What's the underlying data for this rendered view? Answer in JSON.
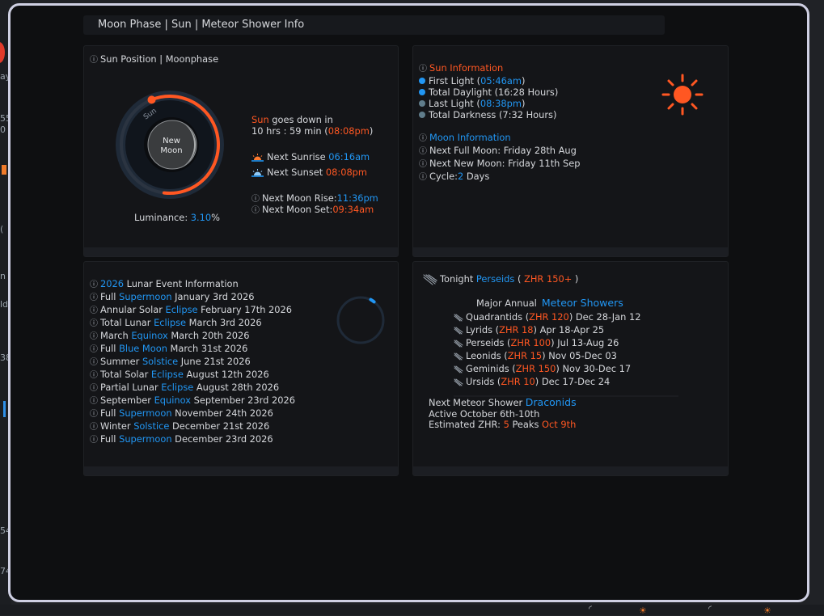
{
  "background": {
    "left_fragments": [
      "ay",
      "55",
      "0",
      "(",
      "n",
      "ld",
      "38",
      "54",
      "74"
    ]
  },
  "modal": {
    "title": "Moon Phase | Sun | Meteor Shower Info"
  },
  "sun_moon_panel": {
    "header": "Sun Position | Moonphase",
    "dial": {
      "sun_label": "Sun",
      "moon_phase_line1": "New",
      "moon_phase_line2": "Moon",
      "sun_progress_fraction": 0.58
    },
    "luminance_label": "Luminance:",
    "luminance_value": "3.10",
    "luminance_unit": "%",
    "sun_word": "Sun",
    "goes_down_text": "goes down in",
    "countdown": "10 hrs : 59 min",
    "countdown_paren_open": "(",
    "countdown_time": "08:08pm",
    "countdown_paren_close": ")",
    "next_sunrise_label": "Next Sunrise",
    "next_sunrise_time": "06:16am",
    "next_sunset_label": "Next Sunset",
    "next_sunset_time": "08:08pm",
    "moon_rise_label": "Next Moon Rise:",
    "moon_rise_time": "11:36pm",
    "moon_set_label": "Next Moon Set:",
    "moon_set_time": "09:34am"
  },
  "sun_info_panel": {
    "sun_header": "Sun Information",
    "first_light_label": "First Light (",
    "first_light_time": "05:46am",
    "first_light_close": ")",
    "total_daylight": "Total Daylight (16:28 Hours)",
    "last_light_label": "Last Light (",
    "last_light_time": "08:38pm",
    "last_light_close": ")",
    "total_darkness": "Total Darkness (7:32 Hours)",
    "moon_header": "Moon Information",
    "next_full_moon": "Next Full Moon: Friday 28th Aug",
    "next_new_moon": "Next New Moon: Friday 11th Sep",
    "cycle_label": "Cycle:",
    "cycle_value": "2",
    "cycle_unit": " Days",
    "colors": {
      "first_light": "#2196f3",
      "daylight": "#2196f3",
      "last_light": "#607d8b",
      "darkness": "#607d8b",
      "sun": "#ff5722"
    }
  },
  "lunar_events_panel": {
    "events": [
      {
        "pre": "",
        "hl": "2026",
        "post": " Lunar Event Information"
      },
      {
        "pre": "Full ",
        "hl": "Supermoon",
        "post": " January 3rd 2026"
      },
      {
        "pre": "Annular Solar ",
        "hl": "Eclipse",
        "post": " February 17th 2026"
      },
      {
        "pre": "Total Lunar ",
        "hl": "Eclipse",
        "post": " March 3rd 2026"
      },
      {
        "pre": "March ",
        "hl": "Equinox",
        "post": " March 20th 2026"
      },
      {
        "pre": "Full ",
        "hl": "Blue Moon",
        "post": " March 31st 2026"
      },
      {
        "pre": "Summer ",
        "hl": "Solstice",
        "post": " June 21st 2026"
      },
      {
        "pre": "Total Solar ",
        "hl": "Eclipse",
        "post": " August 12th 2026"
      },
      {
        "pre": "Partial Lunar ",
        "hl": "Eclipse",
        "post": " August 28th 2026"
      },
      {
        "pre": "September ",
        "hl": "Equinox",
        "post": " September 23rd 2026"
      },
      {
        "pre": "Full ",
        "hl": "Supermoon",
        "post": " November 24th 2026"
      },
      {
        "pre": "Winter ",
        "hl": "Solstice",
        "post": " December 21st 2026"
      },
      {
        "pre": "Full ",
        "hl": "Supermoon",
        "post": " December 23rd 2026"
      }
    ]
  },
  "meteor_panel": {
    "tonight_label": "Tonight",
    "tonight_shower": "Perseids",
    "tonight_zhr": "ZHR 150+",
    "paren_open": "(",
    "paren_close": ")",
    "major_label": "Major Annual",
    "major_title": "Meteor Showers",
    "showers": [
      {
        "name": "Quadrantids",
        "zhr": "ZHR 120",
        "dates": "Dec 28-Jan 12"
      },
      {
        "name": "Lyrids",
        "zhr": "ZHR 18",
        "dates": "Apr 18-Apr 25"
      },
      {
        "name": "Perseids",
        "zhr": "ZHR 100",
        "dates": "Jul 13-Aug 26"
      },
      {
        "name": "Leonids",
        "zhr": "ZHR 15",
        "dates": "Nov 05-Dec 03"
      },
      {
        "name": "Geminids",
        "zhr": "ZHR 150",
        "dates": "Nov 30-Dec 17"
      },
      {
        "name": "Ursids",
        "zhr": "ZHR 10",
        "dates": "Dec 17-Dec 24"
      }
    ],
    "next_label": "Next Meteor Shower",
    "next_name": "Draconids",
    "active": "Active October 6th-10th",
    "est_label": "Estimated ZHR:",
    "est_value": "5",
    "peaks_label": "Peaks",
    "peaks_value": "Oct 9th"
  }
}
